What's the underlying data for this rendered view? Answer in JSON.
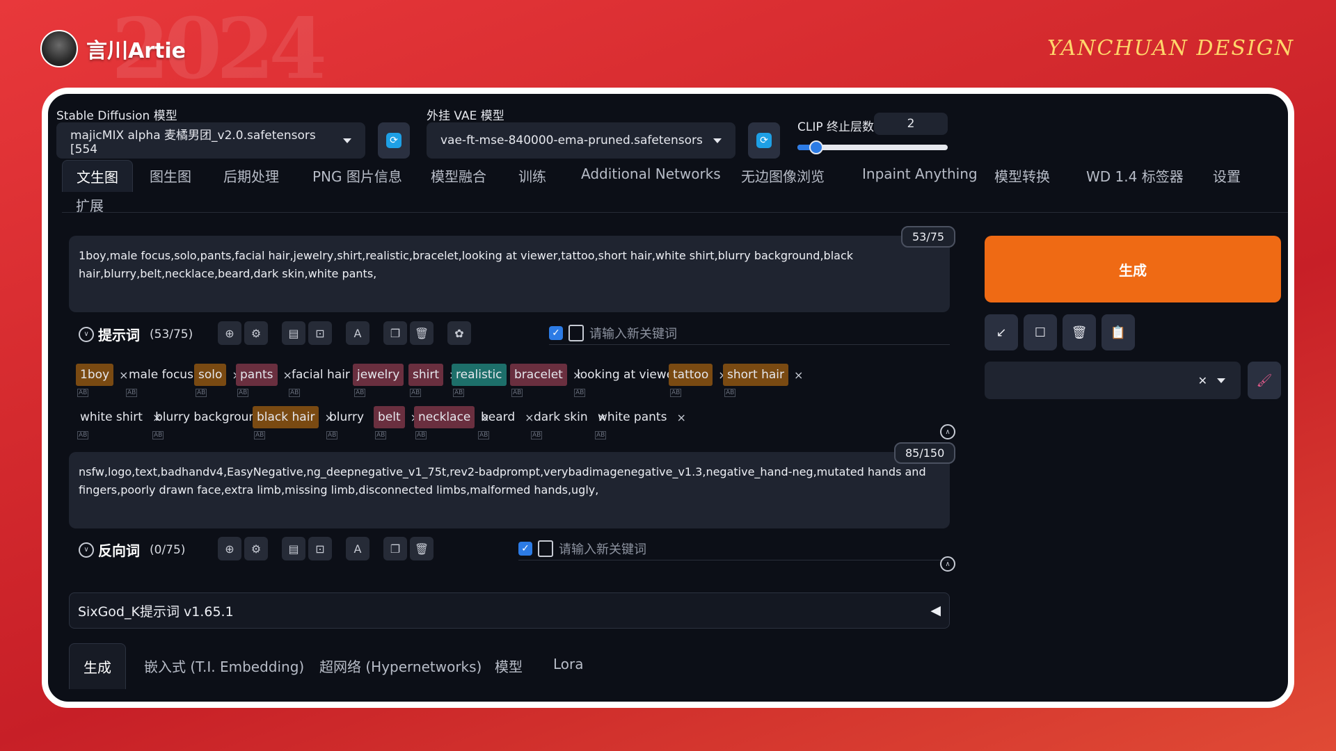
{
  "brand": {
    "name": "言川Artie",
    "design": "YANCHUAN DESIGN"
  },
  "models": {
    "sd_label": "Stable Diffusion 模型",
    "sd_value": "majicMIX alpha 麦橘男团_v2.0.safetensors [554",
    "vae_label": "外挂 VAE 模型",
    "vae_value": "vae-ft-mse-840000-ema-pruned.safetensors",
    "refresh_icon": "refresh-icon",
    "clip_label": "CLIP 终止层数",
    "clip_value": "2",
    "clip_fraction": 0.08
  },
  "tabs": [
    "文生图",
    "图生图",
    "后期处理",
    "PNG 图片信息",
    "模型融合",
    "训练",
    "Additional Networks",
    "无边图像浏览",
    "Inpaint Anything",
    "模型转换",
    "WD 1.4 标签器",
    "设置",
    "扩展"
  ],
  "prompt": {
    "text": "1boy,male focus,solo,pants,facial hair,jewelry,shirt,realistic,bracelet,looking at viewer,tattoo,short hair,white shirt,blurry background,black hair,blurry,belt,necklace,beard,dark skin,white pants,",
    "counter": "53/75",
    "title": "提示词",
    "count": "(53/75)",
    "keyword_placeholder": "请输入新关键词",
    "tags_row1": [
      {
        "text": "1boy",
        "style": "o"
      },
      {
        "text": "male focus",
        "style": ""
      },
      {
        "text": "solo",
        "style": "o"
      },
      {
        "text": "pants",
        "style": "p"
      },
      {
        "text": "facial hair",
        "style": ""
      },
      {
        "text": "jewelry",
        "style": "p"
      },
      {
        "text": "shirt",
        "style": "p"
      },
      {
        "text": "realistic",
        "style": "g"
      },
      {
        "text": "bracelet",
        "style": "p"
      },
      {
        "text": "looking at viewer",
        "style": ""
      },
      {
        "text": "tattoo",
        "style": "o"
      },
      {
        "text": "short hair",
        "style": "o"
      }
    ],
    "tags_row2": [
      {
        "text": "white shirt",
        "style": ""
      },
      {
        "text": "blurry background",
        "style": ""
      },
      {
        "text": "black hair",
        "style": "o"
      },
      {
        "text": "blurry",
        "style": ""
      },
      {
        "text": "belt",
        "style": "p"
      },
      {
        "text": "necklace",
        "style": "p"
      },
      {
        "text": "beard",
        "style": ""
      },
      {
        "text": "dark skin",
        "style": ""
      },
      {
        "text": "white pants",
        "style": ""
      }
    ]
  },
  "negative": {
    "text": "nsfw,logo,text,badhandv4,EasyNegative,ng_deepnegative_v1_75t,rev2-badprompt,verybadimagenegative_v1.3,negative_hand-neg,mutated hands and fingers,poorly drawn face,extra limb,missing limb,disconnected limbs,malformed hands,ugly,",
    "counter": "85/150",
    "title": "反向词",
    "count": "(0/75)",
    "keyword_placeholder": "请输入新关键词"
  },
  "sixgod": {
    "label": "SixGod_K提示词 v1.65.1",
    "arrow": "◀"
  },
  "bottom_tabs": [
    "生成",
    "嵌入式 (T.I. Embedding)",
    "超网络 (Hypernetworks)",
    "模型",
    "Lora"
  ],
  "generate": {
    "label": "生成"
  },
  "tag_close": "×",
  "tag_subicon": "AB"
}
